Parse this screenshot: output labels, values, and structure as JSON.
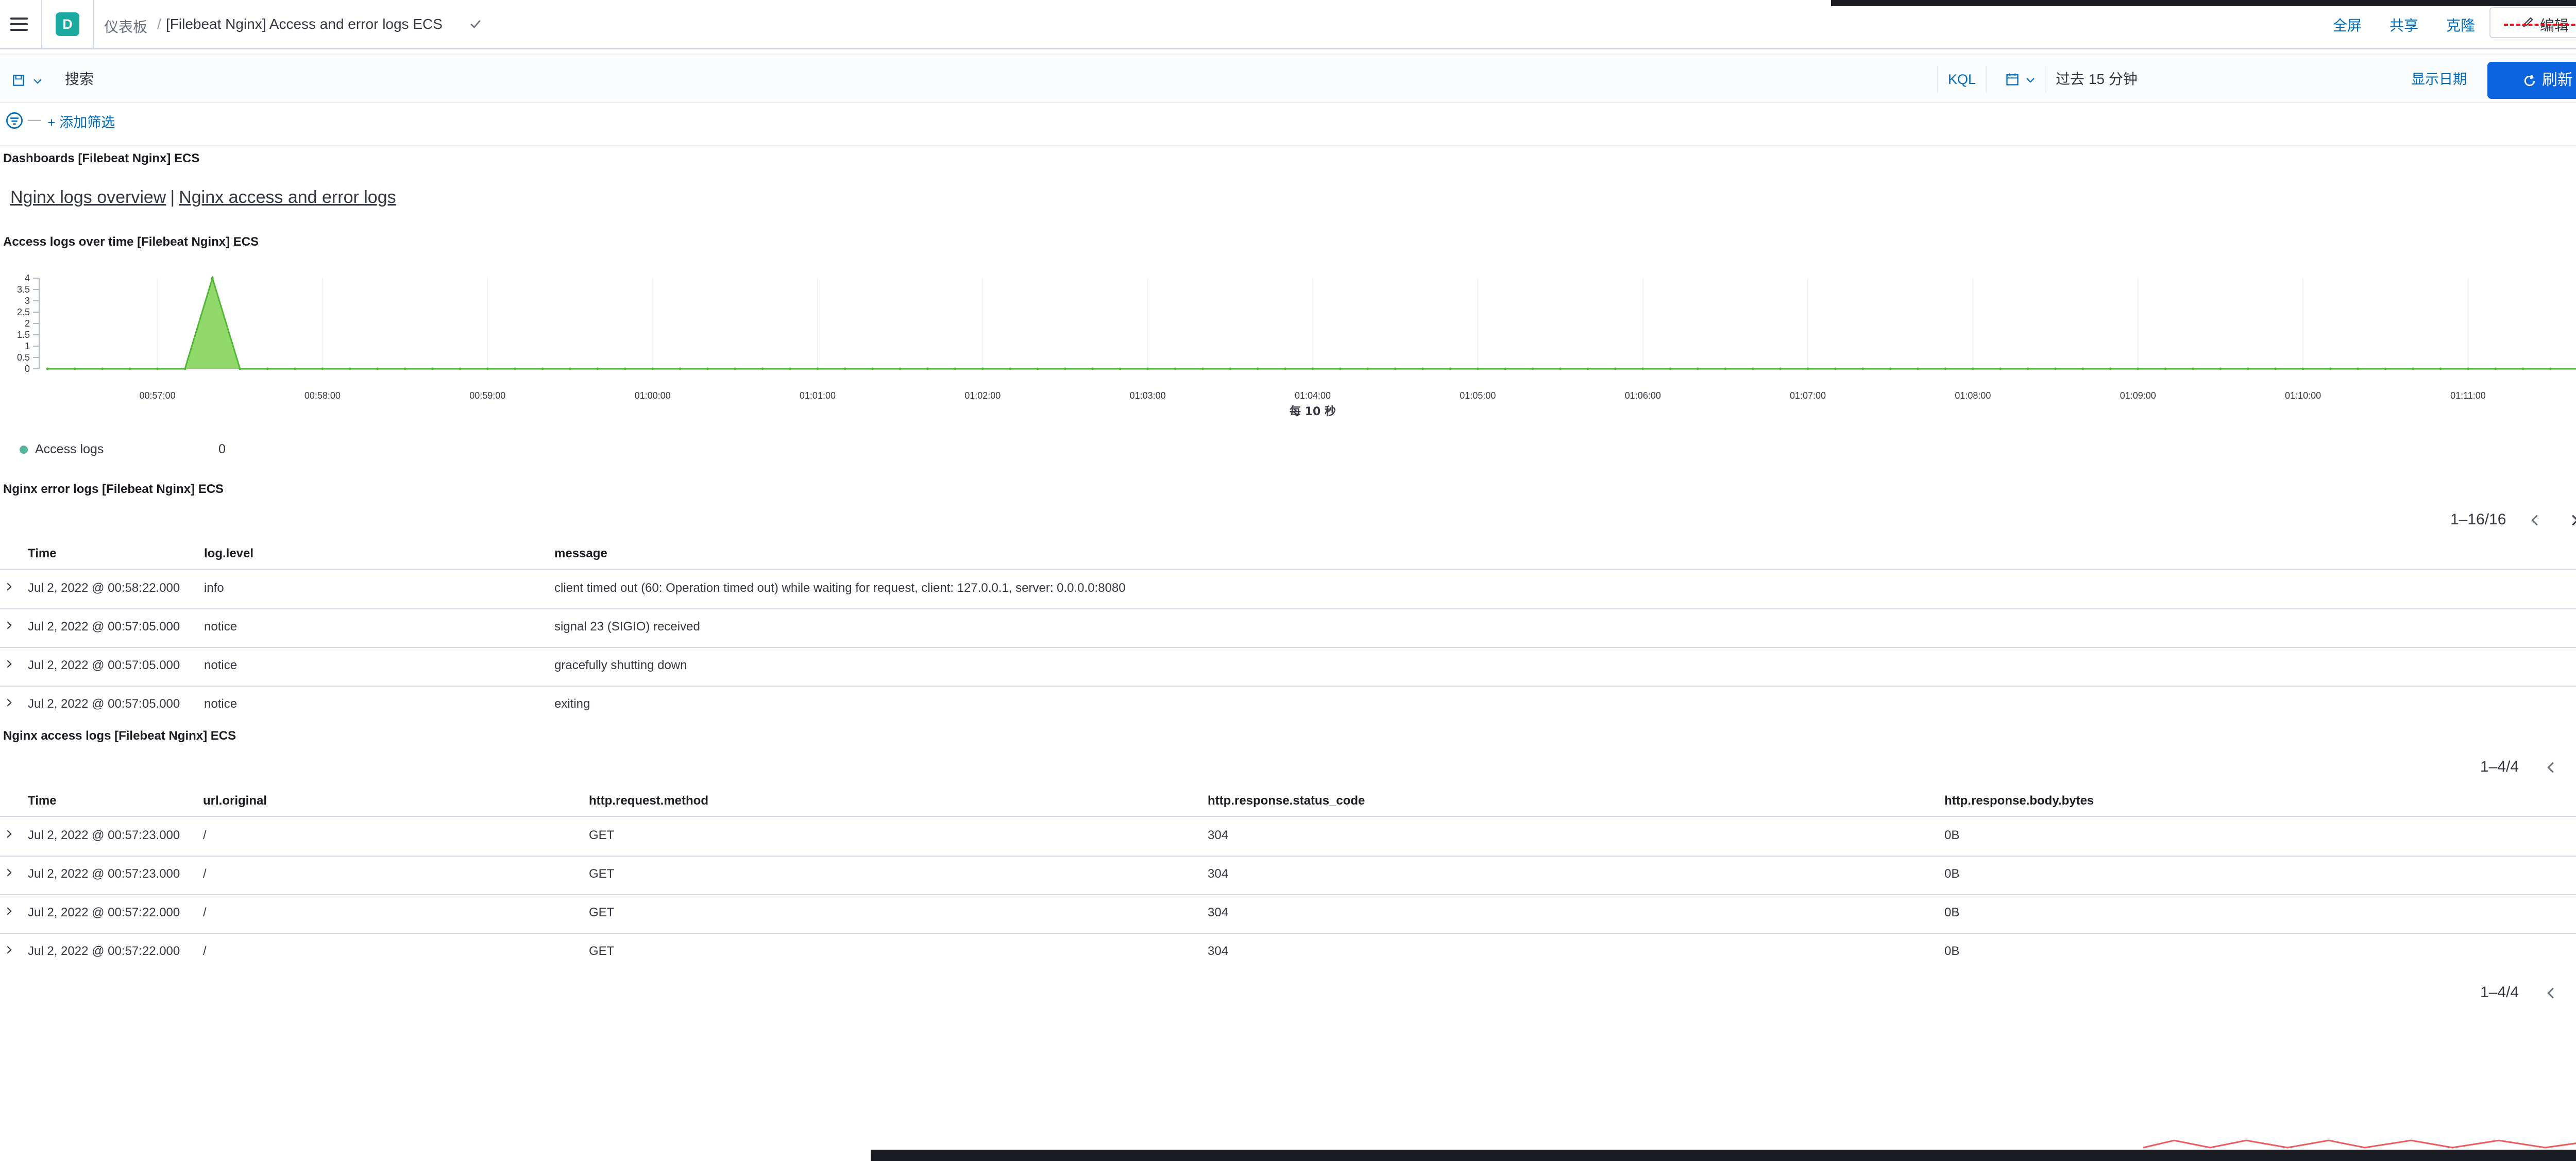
{
  "header": {
    "avatar_letter": "D",
    "crumb_home": "仪表板",
    "crumb_sep": "/",
    "crumb_current": "[Filebeat Nginx] Access and error logs ECS",
    "links": [
      "全屏",
      "共享",
      "克隆"
    ],
    "edit_label": "编辑"
  },
  "query": {
    "search_placeholder": "搜索",
    "kql_label": "KQL",
    "date_range": "过去 15 分钟",
    "show_dates": "显示日期",
    "refresh_label": "刷新",
    "filter_dash": "—",
    "add_filter": "+ 添加筛选"
  },
  "panels": {
    "links_panel_title": "Dashboards [Filebeat Nginx] ECS",
    "link1": "Nginx logs overview",
    "link_sep": "|",
    "link2": "Nginx access and error logs",
    "chart_panel_title": "Access logs over time [Filebeat Nginx] ECS",
    "error_panel_title": "Nginx error logs [Filebeat Nginx] ECS",
    "access_panel_title": "Nginx access logs [Filebeat Nginx] ECS"
  },
  "chart_data": {
    "type": "area",
    "title": "Access logs over time [Filebeat Nginx] ECS",
    "xlabel": "每 10 秒",
    "ylabel": "",
    "ylim": [
      0,
      4
    ],
    "y_ticks": [
      "0",
      "0.5",
      "1",
      "1.5",
      "2",
      "2.5",
      "3",
      "3.5",
      "4"
    ],
    "x_ticks": [
      "00:57:00",
      "00:58:00",
      "00:59:00",
      "01:00:00",
      "01:01:00",
      "01:02:00",
      "01:03:00",
      "01:04:00",
      "01:05:00",
      "01:06:00",
      "01:07:00",
      "01:08:00",
      "01:09:00",
      "01:10:00",
      "01:11:00"
    ],
    "series": [
      {
        "name": "Access logs",
        "color": "#54b399",
        "points": [
          [
            "00:56:20",
            0
          ],
          [
            "00:57:10",
            0
          ],
          [
            "00:57:20",
            4
          ],
          [
            "00:57:30",
            0
          ],
          [
            "01:11:40",
            0
          ]
        ]
      }
    ],
    "legend": {
      "label": "Access logs",
      "value": "0",
      "placement": "bottom-left"
    }
  },
  "error_table": {
    "pager": "1–16/16",
    "columns": [
      "Time",
      "log.level",
      "message"
    ],
    "rows": [
      [
        "Jul 2, 2022 @ 00:58:22.000",
        "info",
        "client timed out (60: Operation timed out) while waiting for request, client: 127.0.0.1, server: 0.0.0.0:8080"
      ],
      [
        "Jul 2, 2022 @ 00:57:05.000",
        "notice",
        "signal 23 (SIGIO) received"
      ],
      [
        "Jul 2, 2022 @ 00:57:05.000",
        "notice",
        "gracefully shutting down"
      ],
      [
        "Jul 2, 2022 @ 00:57:05.000",
        "notice",
        "exiting"
      ]
    ]
  },
  "access_table": {
    "pager": "1–4/4",
    "pager_bottom": "1–4/4",
    "columns": [
      "Time",
      "url.original",
      "http.request.method",
      "http.response.status_code",
      "http.response.body.bytes"
    ],
    "rows": [
      [
        "Jul 2, 2022 @ 00:57:23.000",
        "/",
        "GET",
        "304",
        "0B"
      ],
      [
        "Jul 2, 2022 @ 00:57:23.000",
        "/",
        "GET",
        "304",
        "0B"
      ],
      [
        "Jul 2, 2022 @ 00:57:22.000",
        "/",
        "GET",
        "304",
        "0B"
      ],
      [
        "Jul 2, 2022 @ 00:57:22.000",
        "/",
        "GET",
        "304",
        "0B"
      ]
    ]
  },
  "colors": {
    "accent": "#006bb8",
    "primary_button": "#0b64dd",
    "series": "#54b399"
  }
}
